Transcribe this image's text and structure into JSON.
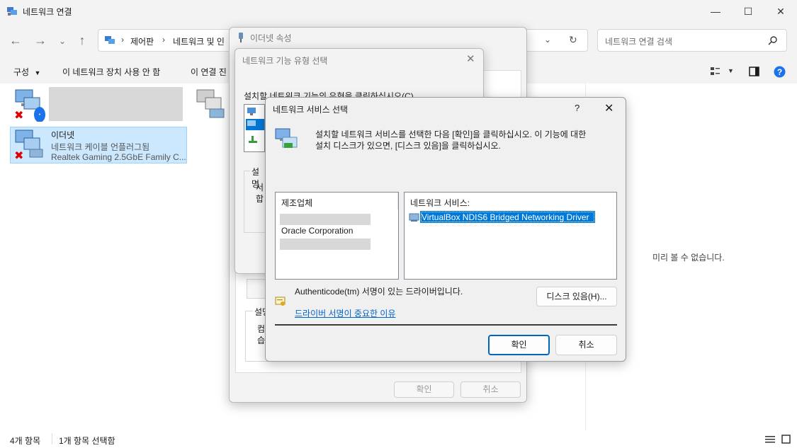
{
  "explorer": {
    "title": "네트워크 연결",
    "breadcrumb": [
      "제어판",
      "네트워크 및 인"
    ],
    "search_placeholder": "네트워크 연결 검색",
    "cmd": {
      "organize": "구성",
      "disable": "이 네트워크 장치 사용 안 함",
      "connect": "이 연결 진"
    },
    "items": [
      {
        "name": "",
        "status": "",
        "adapter": ""
      },
      {
        "name": "이더넷",
        "status": "네트워크 케이블 언플러그됨",
        "adapter": "Realtek Gaming 2.5GbE Family C..."
      }
    ],
    "preview_text": "미리 볼 수 없습니다.",
    "status": {
      "count": "4개 항목",
      "selected": "1개 항목 선택함"
    }
  },
  "props_dialog": {
    "title": "이더넷 속성",
    "ok": "확인",
    "cancel": "취소",
    "desc_group": "설명",
    "desc_group2": "설명",
    "frag1": "컴",
    "frag2": "습"
  },
  "type_dialog": {
    "title": "네트워크 기능 유형 선택",
    "prompt": "설치할 네트워크 기능의 유형을 클릭하십시오(C)",
    "desc_group": "설명",
    "frag1": "서",
    "frag2": "합"
  },
  "service_dialog": {
    "title": "네트워크 서비스 선택",
    "help": "?",
    "instruction_line1": "설치할 네트워크 서비스를 선택한 다음 [확인]을 클릭하십시오. 이 기능에 대한",
    "instruction_line2": "설치 디스크가 있으면, [디스크 있음]을 클릭하십시오.",
    "manufacturer_header": "제조업체",
    "manufacturers": [
      "",
      "Oracle Corporation",
      ""
    ],
    "service_header": "네트워크 서비스:",
    "services": [
      "VirtualBox NDIS6 Bridged Networking Driver"
    ],
    "signed_text": "Authenticode(tm) 서명이 있는 드라이버입니다.",
    "signing_link": "드라이버 서명이 중요한 이유",
    "have_disk": "디스크 있음(H)...",
    "ok": "확인",
    "cancel": "취소"
  },
  "colors": {
    "accent": "#0067c0",
    "selection": "#0078d7"
  }
}
